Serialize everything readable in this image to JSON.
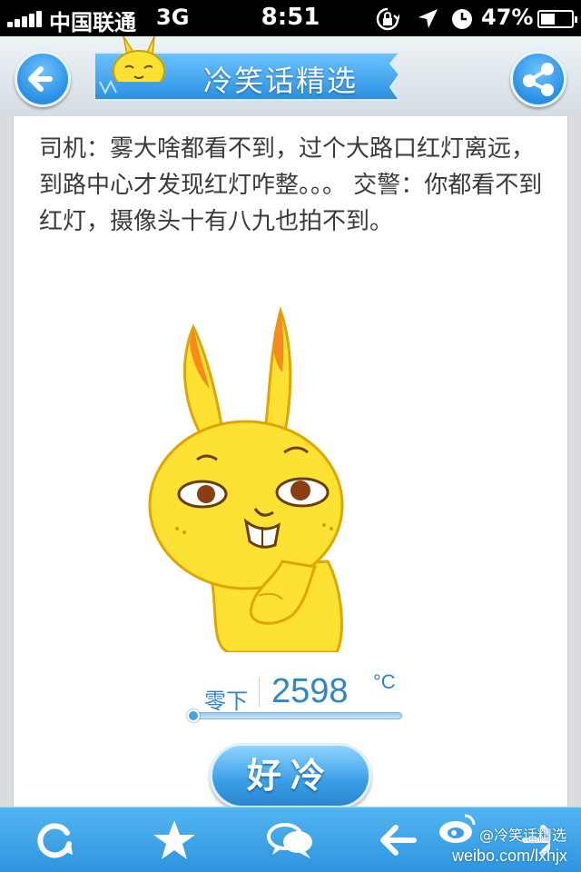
{
  "status_bar": {
    "carrier": "中国联通",
    "network": "3G",
    "time": "8:51",
    "battery_percent": "47%",
    "battery_level": 0.47,
    "icons": [
      "signal-bars-icon",
      "rotation-lock-icon",
      "location-arrow-icon",
      "clock-icon",
      "battery-icon"
    ]
  },
  "header": {
    "title": "冷笑话精选",
    "back_icon": "arrow-left-icon",
    "share_icon": "share-icon"
  },
  "joke": {
    "text": "司机：雾大啥都看不到，过个大路口红灯离远，到路中心才发现红灯咋整。。。 交警：你都看不到红灯，摄像头十有八九也拍不到。"
  },
  "coldness": {
    "label": "零下",
    "value": "2598",
    "unit": "°C",
    "level": 0.0
  },
  "cold_button": {
    "label": "好冷"
  },
  "toolbar": {
    "items": [
      "refresh-icon",
      "star-icon",
      "comments-icon",
      "arrow-left-icon",
      "arrow-right-icon"
    ]
  },
  "watermark": {
    "name": "@冷笑话精选",
    "url": "weibo.com/lxhjx"
  },
  "colors": {
    "accent": "#2d86c8",
    "toolbar": "#3a9ee6",
    "mascot": "#fde233"
  }
}
